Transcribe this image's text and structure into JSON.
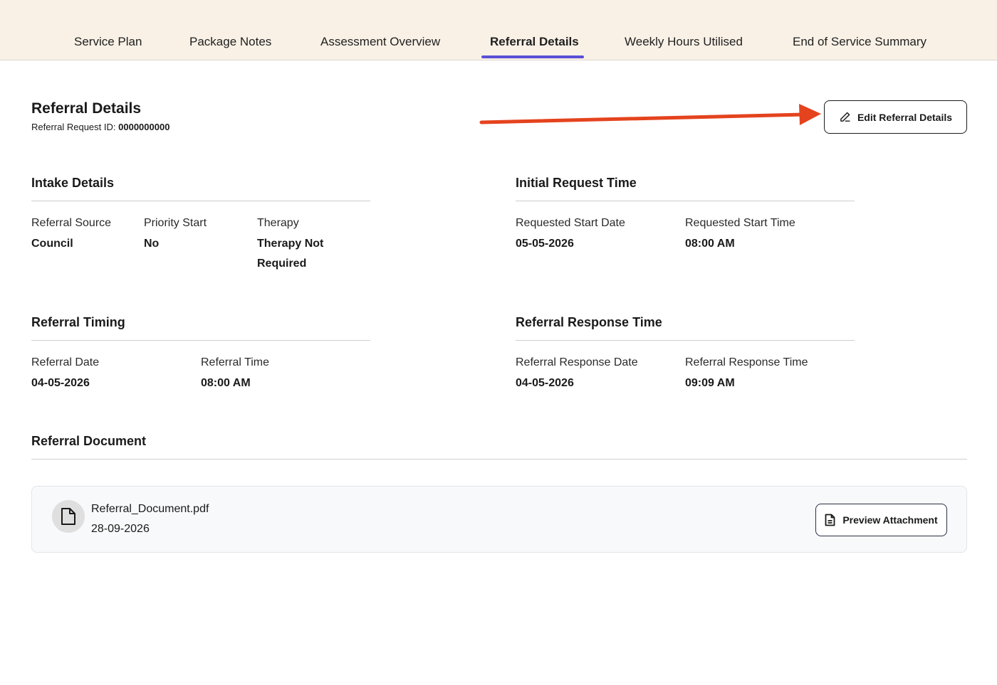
{
  "tabs": {
    "service_plan": "Service Plan",
    "package_notes": "Package Notes",
    "assessment_overview": "Assessment Overview",
    "referral_details": "Referral Details",
    "weekly_hours": "Weekly Hours Utilised",
    "end_of_service": "End of Service Summary",
    "active": "Referral Details"
  },
  "header": {
    "title": "Referral Details",
    "request_id_label": "Referral Request ID:",
    "request_id_value": "0000000000",
    "edit_button": "Edit Referral Details"
  },
  "intake": {
    "title": "Intake Details",
    "referral_source_label": "Referral Source",
    "referral_source_value": "Council",
    "priority_start_label": "Priority Start",
    "priority_start_value": "No",
    "therapy_label": "Therapy",
    "therapy_value_line1": "Therapy Not",
    "therapy_value_line2": "Required"
  },
  "initial_request": {
    "title": "Initial Request Time",
    "start_date_label": "Requested Start Date",
    "start_date_value": "05-05-2026",
    "start_time_label": "Requested Start Time",
    "start_time_value": "08:00 AM"
  },
  "timing": {
    "title": "Referral Timing",
    "date_label": "Referral Date",
    "date_value": "04-05-2026",
    "time_label": "Referral Time",
    "time_value": "08:00 AM"
  },
  "response": {
    "title": "Referral Response Time",
    "date_label": "Referral Response Date",
    "date_value": "04-05-2026",
    "time_label": "Referral Response Time",
    "time_value": "09:09 AM"
  },
  "document": {
    "title": "Referral Document",
    "file_name": "Referral_Document.pdf",
    "file_date": "28-09-2026",
    "preview_button": "Preview Attachment"
  },
  "colors": {
    "topbar_bg": "#f9f1e6",
    "tab_accent": "#5a4fd6",
    "annotation_arrow": "#e4431e"
  },
  "icons": [
    "pencil-icon",
    "file-icon",
    "document-text-icon"
  ]
}
